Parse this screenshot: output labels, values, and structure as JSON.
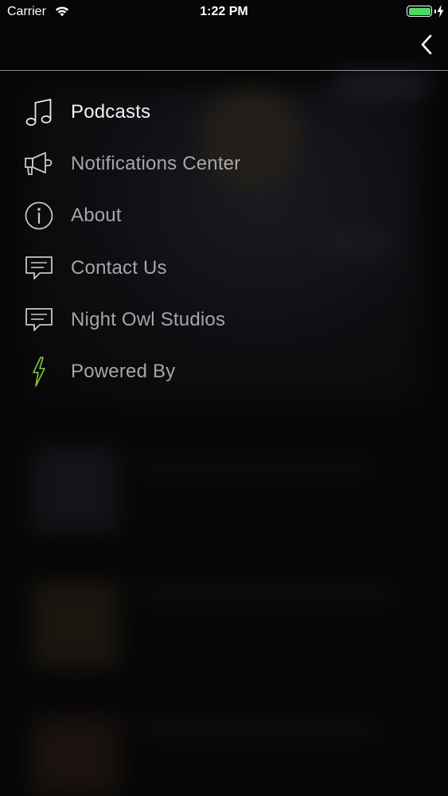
{
  "status_bar": {
    "carrier": "Carrier",
    "time": "1:22 PM",
    "wifi_icon": "wifi-icon",
    "battery_icon": "battery-full-icon",
    "battery_color": "#4cd964",
    "charging_icon": "charging-bolt-icon"
  },
  "nav": {
    "back_icon": "chevron-left-icon"
  },
  "menu": {
    "items": [
      {
        "label": "Podcasts",
        "icon": "music-note-icon",
        "active": true
      },
      {
        "label": "Notifications Center",
        "icon": "megaphone-icon",
        "active": false
      },
      {
        "label": "About",
        "icon": "info-icon",
        "active": false
      },
      {
        "label": "Contact Us",
        "icon": "chat-bubble-icon",
        "active": false
      },
      {
        "label": "Night Owl Studios",
        "icon": "chat-bubble-icon",
        "active": false
      },
      {
        "label": "Powered By",
        "icon": "lightning-bolt-icon",
        "active": false
      }
    ]
  },
  "colors": {
    "background": "#060607",
    "active_text": "#f2f2f4",
    "inactive_text": "#a6a6aa",
    "accent_bolt": "#7ecb3a"
  }
}
